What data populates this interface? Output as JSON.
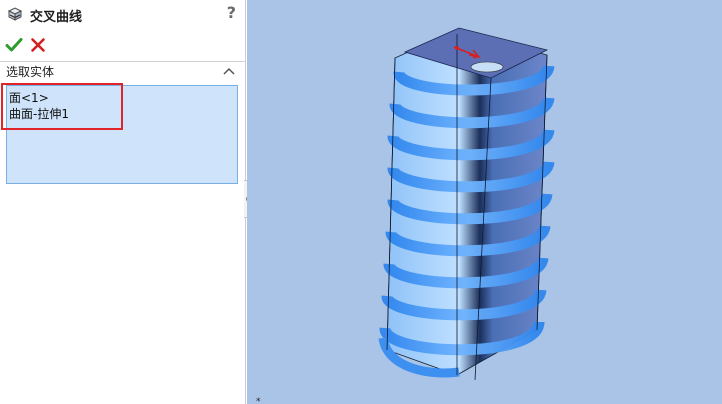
{
  "panel": {
    "title": "交叉曲线",
    "help": "?",
    "section_title": "选取实体",
    "selections": [
      "面<1>",
      "曲面-拉伸1"
    ]
  },
  "colors": {
    "accent_blue": "#78b0e6",
    "selection_bg": "#cfe4fb",
    "viewport_bg": "#a9c4e6",
    "highlight_red": "#e3232a",
    "ok_green": "#2e9b2e",
    "cancel_red": "#d42020",
    "model_blue": "#3d8ff0"
  },
  "icons": {
    "feature": "intersection-curve-icon",
    "ok": "checkmark-icon",
    "cancel": "close-icon",
    "collapse": "chevron-up-icon",
    "help": "question-mark-icon"
  },
  "viewport": {
    "triad": "*"
  }
}
